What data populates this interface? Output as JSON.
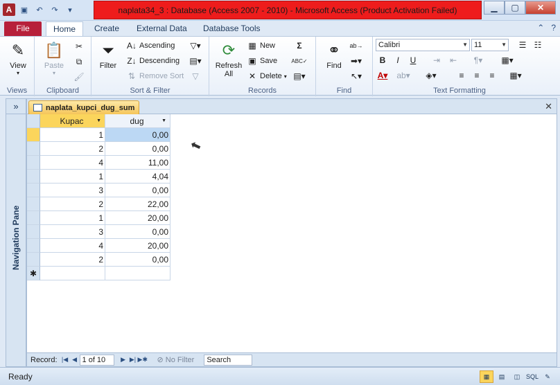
{
  "window": {
    "title": "naplata34_3 : Database (Access 2007 - 2010)  -  Microsoft Access (Product Activation Failed)"
  },
  "tabs": [
    "File",
    "Home",
    "Create",
    "External Data",
    "Database Tools"
  ],
  "ribbon": {
    "views": {
      "view_label": "View",
      "group_label": "Views"
    },
    "clipboard": {
      "paste_label": "Paste",
      "group_label": "Clipboard"
    },
    "sort_filter": {
      "filter_label": "Filter",
      "ascending_label": "Ascending",
      "descending_label": "Descending",
      "remove_sort_label": "Remove Sort",
      "group_label": "Sort & Filter"
    },
    "records": {
      "refresh_label": "Refresh All",
      "new_label": "New",
      "save_label": "Save",
      "delete_label": "Delete",
      "group_label": "Records"
    },
    "find": {
      "find_label": "Find",
      "group_label": "Find"
    },
    "text_formatting": {
      "font_name": "Calibri",
      "font_size": "11",
      "bold": "B",
      "italic": "I",
      "underline": "U",
      "group_label": "Text Formatting"
    }
  },
  "nav_pane": {
    "toggle": "»",
    "label": "Navigation Pane"
  },
  "document": {
    "tab_title": "naplata_kupci_dug_sum",
    "close": "✕",
    "columns": [
      "Kupac",
      "dug"
    ],
    "rows": [
      [
        "1",
        "0,00"
      ],
      [
        "2",
        "0,00"
      ],
      [
        "4",
        "11,00"
      ],
      [
        "1",
        "4,04"
      ],
      [
        "3",
        "0,00"
      ],
      [
        "2",
        "22,00"
      ],
      [
        "1",
        "20,00"
      ],
      [
        "3",
        "0,00"
      ],
      [
        "4",
        "20,00"
      ],
      [
        "2",
        "0,00"
      ]
    ],
    "new_row_marker": "✱"
  },
  "record_nav": {
    "label": "Record:",
    "position": "1 of 10",
    "filter_label": "No Filter",
    "search_placeholder": "Search"
  },
  "status": {
    "text": "Ready",
    "sql": "SQL"
  }
}
